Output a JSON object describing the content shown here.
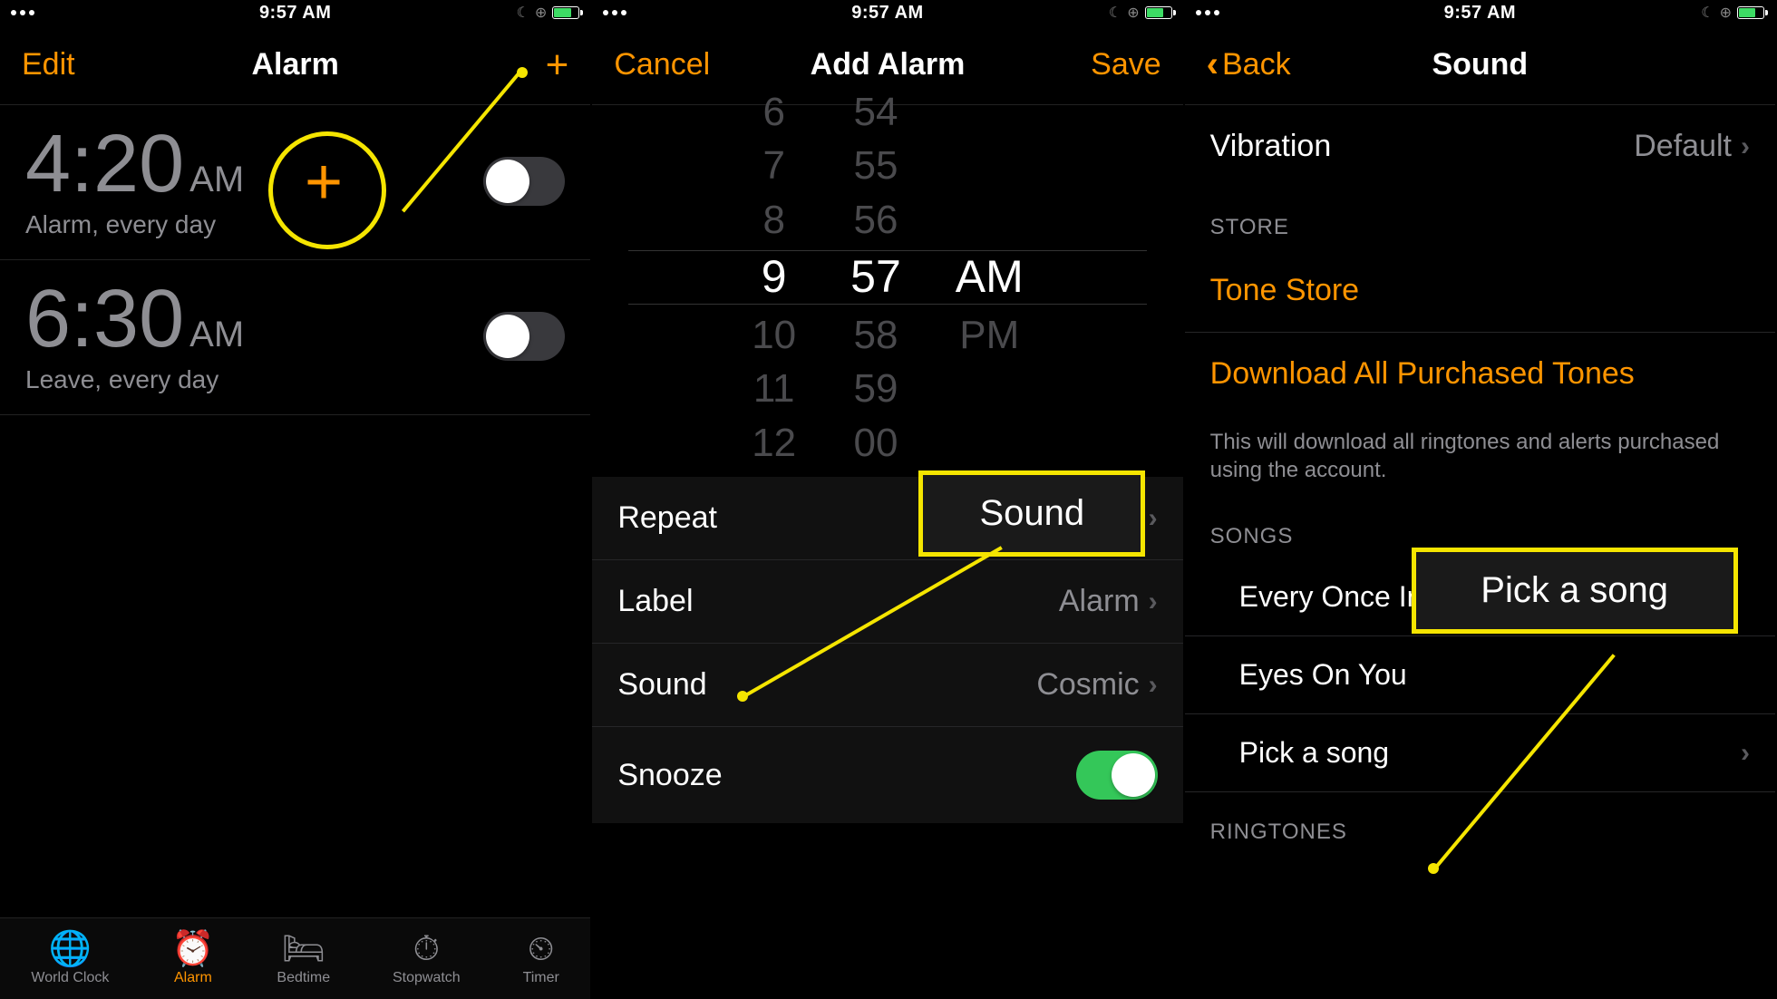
{
  "status": {
    "time": "9:57 AM"
  },
  "screen1": {
    "nav": {
      "left": "Edit",
      "title": "Alarm"
    },
    "alarms": [
      {
        "time": "4:20",
        "ampm": "AM",
        "label": "Alarm, every day",
        "on": false
      },
      {
        "time": "6:30",
        "ampm": "AM",
        "label": "Leave, every day",
        "on": false
      }
    ],
    "tabs": [
      "World Clock",
      "Alarm",
      "Bedtime",
      "Stopwatch",
      "Timer"
    ],
    "callout_plus_symbol": "+"
  },
  "screen2": {
    "nav": {
      "left": "Cancel",
      "title": "Add Alarm",
      "right": "Save"
    },
    "picker": {
      "hours": [
        "6",
        "7",
        "8",
        "9",
        "10",
        "11",
        "12"
      ],
      "minutes": [
        "54",
        "55",
        "56",
        "57",
        "58",
        "59",
        "00"
      ],
      "ampm": [
        "AM",
        "PM"
      ],
      "selected_idx": 3
    },
    "settings": {
      "repeat_label": "Repeat",
      "label_label": "Label",
      "label_value": "Alarm",
      "sound_label": "Sound",
      "sound_value": "Cosmic",
      "snooze_label": "Snooze",
      "snooze_on": true
    },
    "callout": "Sound"
  },
  "screen3": {
    "nav": {
      "back": "Back",
      "title": "Sound"
    },
    "vibration": {
      "label": "Vibration",
      "value": "Default"
    },
    "store_header": "STORE",
    "tone_store": "Tone Store",
    "download_all": "Download All Purchased Tones",
    "download_footer": "This will download all ringtones and alerts purchased using the account.",
    "songs_header": "SONGS",
    "songs": [
      "Every Once In A While",
      "Eyes On You",
      "Pick a song"
    ],
    "ringtones_header": "RINGTONES",
    "callout": "Pick a song"
  }
}
